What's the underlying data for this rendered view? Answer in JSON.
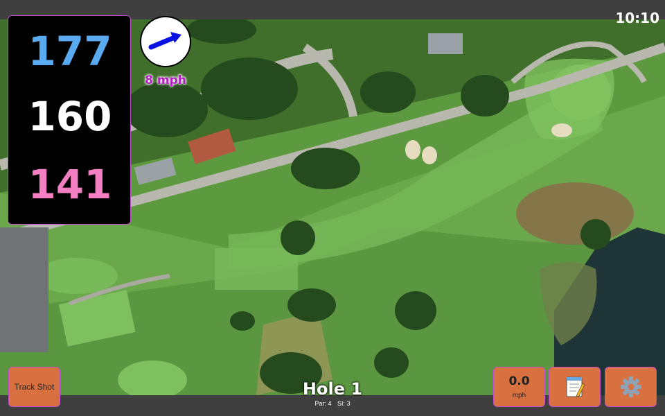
{
  "status_bar": {
    "time": "10:10"
  },
  "distances": {
    "back": "177",
    "middle": "160",
    "front": "141",
    "colors": {
      "back": "#5aaaf2",
      "middle": "#ffffff",
      "front": "#f47ec2"
    }
  },
  "wind": {
    "speed_label": "8 mph",
    "label_color": "#b21fc0",
    "arrow_color": "#0a11e3",
    "arrow_icon": "wind-direction-arrow-icon"
  },
  "hole": {
    "title": "Hole 1",
    "par_label": "Par: 4",
    "si_label": "SI: 3"
  },
  "controls": {
    "track_shot_label": "Track Shot",
    "shot_speed": {
      "value": "0.0",
      "unit": "mph"
    },
    "notes_icon": "notepad-icon",
    "settings_icon": "gear-icon",
    "button_color": "#d8703f",
    "button_border_color": "#c24fcf"
  },
  "map": {
    "view": "satellite",
    "icons": [
      "tree-icon",
      "house-icon",
      "bunker-icon",
      "green-icon",
      "pond-icon",
      "parking-lot-icon"
    ]
  }
}
